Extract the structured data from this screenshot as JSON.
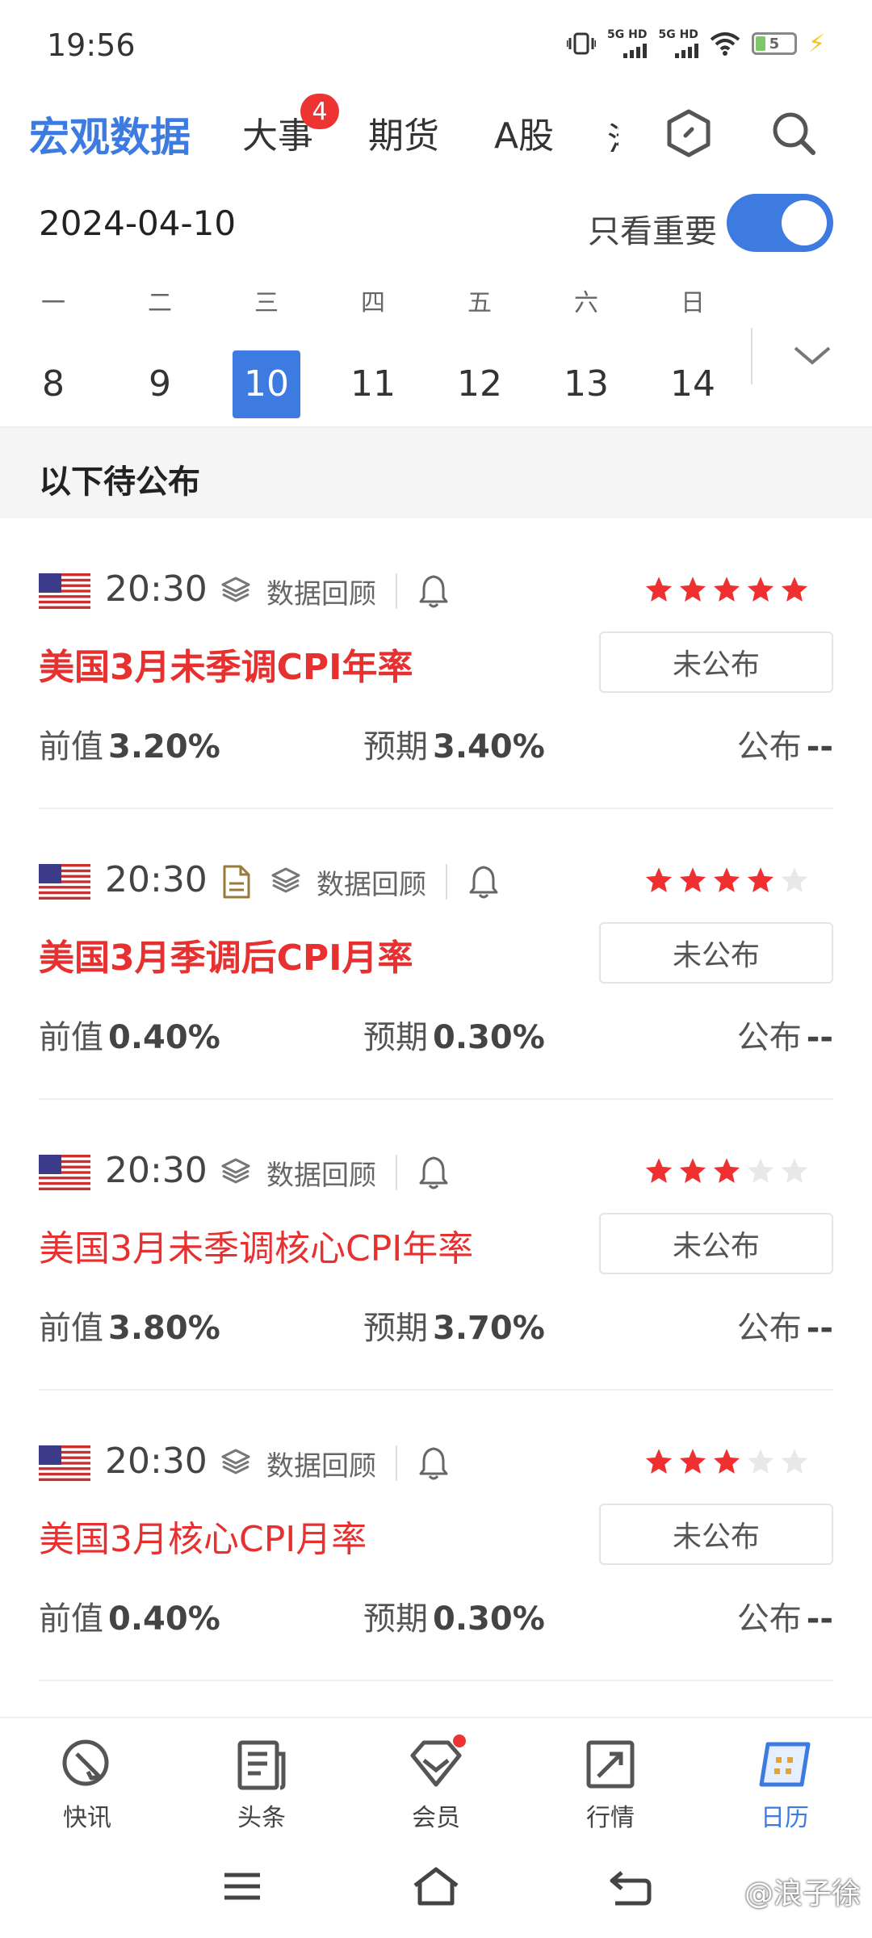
{
  "status_bar": {
    "time": "19:56",
    "network1": "5G HD",
    "network2": "5G HD",
    "battery": "5"
  },
  "top_nav": {
    "tabs": [
      {
        "label": "宏观数据",
        "active": true
      },
      {
        "label": "大事",
        "badge": "4"
      },
      {
        "label": "期货"
      },
      {
        "label": "A股"
      }
    ],
    "clipped_tab": "港",
    "icons": [
      "hexagon-icon",
      "search-icon"
    ]
  },
  "date_bar": {
    "date": "2024-04-10",
    "toggle_label": "只看重要",
    "toggle_on": true
  },
  "calendar": {
    "weekdays": [
      "一",
      "二",
      "三",
      "四",
      "五",
      "六",
      "日"
    ],
    "days": [
      "8",
      "9",
      "10",
      "11",
      "12",
      "13",
      "14"
    ],
    "selected_index": 2
  },
  "section": {
    "title": "以下待公布"
  },
  "labels": {
    "review": "数据回顾",
    "prev": "前值",
    "forecast": "预期",
    "actual": "公布"
  },
  "events": [
    {
      "time": "20:30",
      "title": "美国3月未季调CPI年率",
      "bold": true,
      "stars": 5,
      "has_doc": false,
      "status": "未公布",
      "prev": "3.20%",
      "forecast": "3.40%",
      "actual": "--"
    },
    {
      "time": "20:30",
      "title": "美国3月季调后CPI月率",
      "bold": true,
      "stars": 4,
      "has_doc": true,
      "status": "未公布",
      "prev": "0.40%",
      "forecast": "0.30%",
      "actual": "--"
    },
    {
      "time": "20:30",
      "title": "美国3月未季调核心CPI年率",
      "bold": false,
      "stars": 3,
      "has_doc": false,
      "status": "未公布",
      "prev": "3.80%",
      "forecast": "3.70%",
      "actual": "--"
    },
    {
      "time": "20:30",
      "title": "美国3月核心CPI月率",
      "bold": false,
      "stars": 3,
      "has_doc": false,
      "status": "未公布",
      "prev": "0.40%",
      "forecast": "0.30%",
      "actual": "--"
    }
  ],
  "bottom_nav": [
    {
      "label": "快讯",
      "icon": "flash-news-icon"
    },
    {
      "label": "头条",
      "icon": "headline-icon"
    },
    {
      "label": "会员",
      "icon": "member-icon",
      "dot": true
    },
    {
      "label": "行情",
      "icon": "market-icon"
    },
    {
      "label": "日历",
      "icon": "calendar-icon",
      "active": true
    }
  ],
  "watermark": "@浪子徐",
  "colors": {
    "accent": "#3d7be0",
    "title_red": "#e73030",
    "star_red": "#f03030",
    "star_gray": "#e8e8e8"
  }
}
